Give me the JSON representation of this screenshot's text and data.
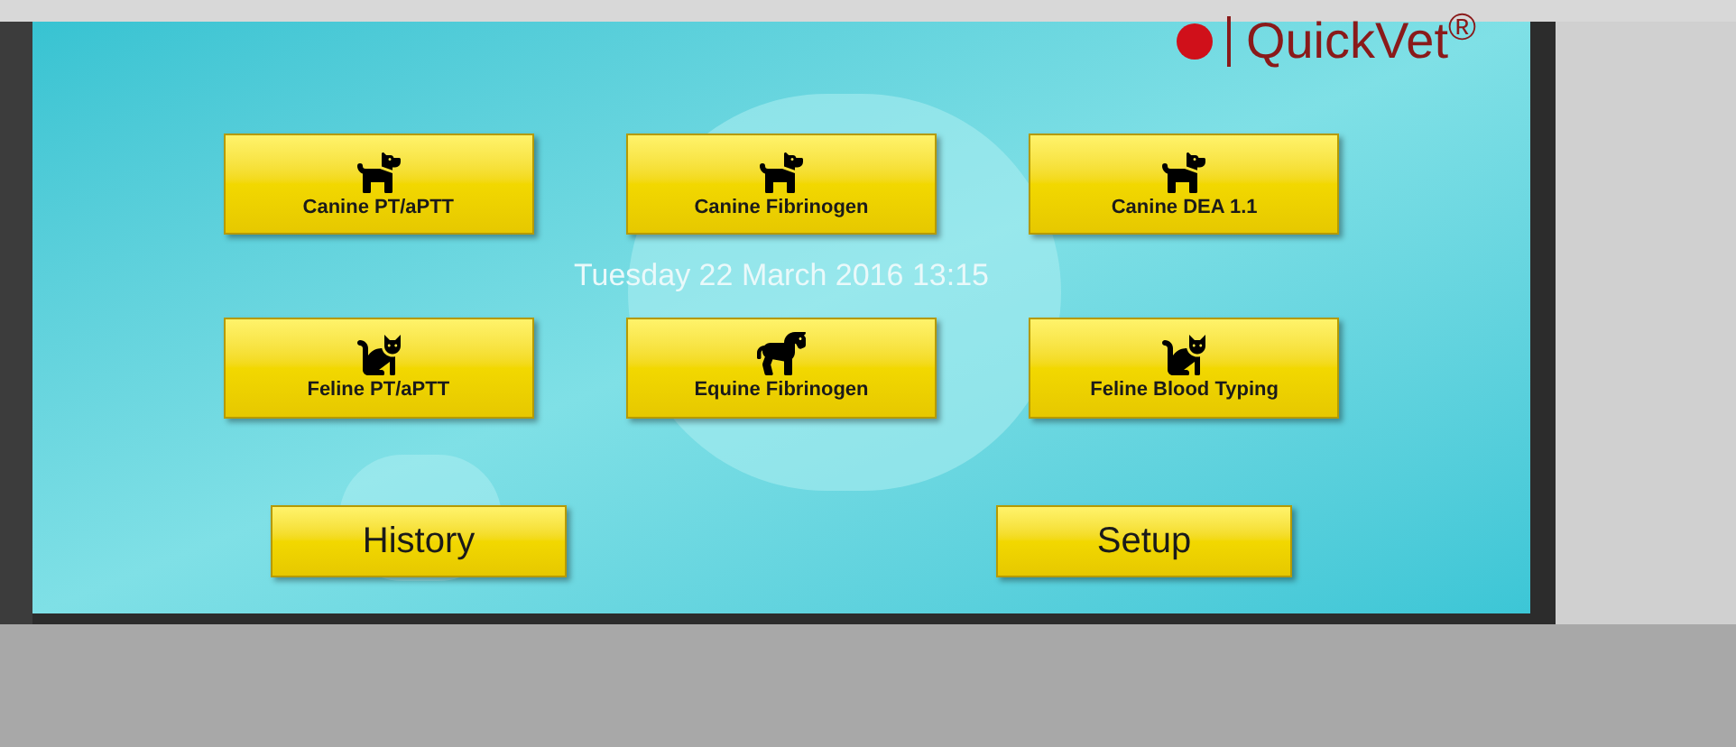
{
  "logo": {
    "text": "QuickVet$^{®}$"
  },
  "tests": [
    {
      "label": "Canine PT/aPTT",
      "kind": "dog"
    },
    {
      "label": "Canine Fibrinogen",
      "kind": "dog"
    },
    {
      "label": "Canine DEA 1.1",
      "kind": "dog"
    },
    {
      "label": "Feline PT/aPTT",
      "kind": "cat"
    },
    {
      "label": "Equine Fibrinogen",
      "kind": "horse"
    },
    {
      "label": "Feline Blood Typing",
      "kind": "cat"
    }
  ],
  "datetime": "Tuesday 22 March 2016 13:15",
  "bottom_buttons": [
    "History",
    "Setup"
  ]
}
